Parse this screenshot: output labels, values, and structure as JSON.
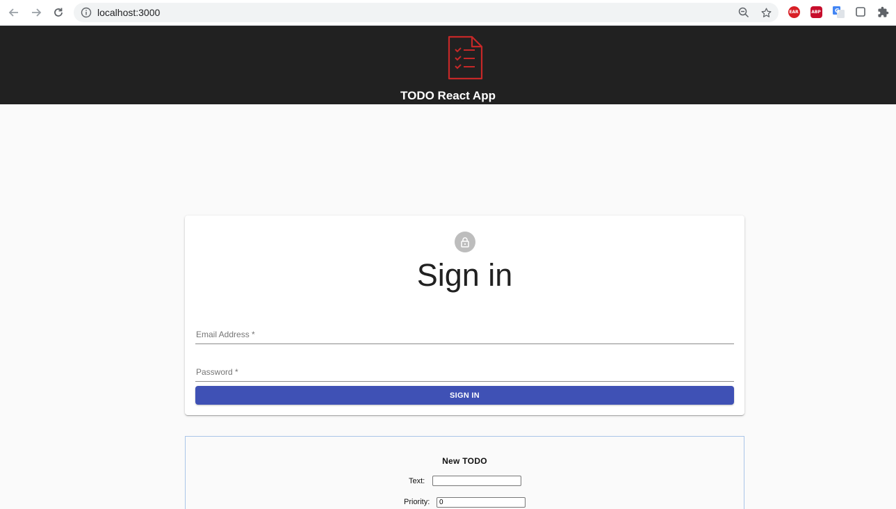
{
  "browser": {
    "url": "localhost:3000",
    "icons": {
      "back": "back-arrow-icon",
      "forward": "forward-arrow-icon",
      "reload": "reload-icon",
      "site_info": "info-icon",
      "zoom": "zoom-out-icon",
      "bookmark": "star-icon"
    },
    "extensions": [
      {
        "name": "ear-extension-icon",
        "badge": "EAR"
      },
      {
        "name": "adblock-plus-extension-icon",
        "badge": "ABP"
      },
      {
        "name": "google-translate-extension-icon",
        "badge": ""
      },
      {
        "name": "square-extension-icon",
        "badge": ""
      },
      {
        "name": "extensions-puzzle-icon",
        "badge": ""
      }
    ]
  },
  "header": {
    "title": "TODO React App",
    "logo_icon": "todo-list-document-icon",
    "background": "#212121",
    "logo_color": "#c62828"
  },
  "signin": {
    "icon": "lock-icon",
    "title": "Sign in",
    "email_label": "Email Address *",
    "password_label": "Password *",
    "button_label": "SIGN IN",
    "button_color": "#3f51b5"
  },
  "new_todo": {
    "title": "New TODO",
    "text_label": "Text:",
    "text_value": "",
    "priority_label": "Priority:",
    "priority_value": "0"
  }
}
